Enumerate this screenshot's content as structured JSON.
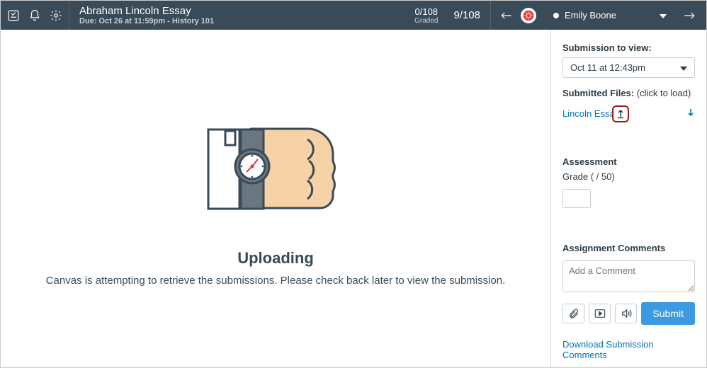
{
  "header": {
    "title": "Abraham Lincoln Essay",
    "subtitle": "Due: Oct 26 at 11:59pm - History 101",
    "graded_count": "0/108",
    "graded_label": "Graded",
    "position": "9/108",
    "student_name": "Emily Boone"
  },
  "main": {
    "heading": "Uploading",
    "message": "Canvas is attempting to retrieve the submissions. Please check back later to view the submission."
  },
  "sidebar": {
    "submission_label": "Submission to view:",
    "submission_selected": "Oct 11 at 12:43pm",
    "submitted_files_label": "Submitted Files:",
    "submitted_files_hint": "(click to load)",
    "file_name": "Lincoln Essa",
    "assessment_label": "Assessment",
    "grade_label": "Grade ( / 50)",
    "comments_label": "Assignment Comments",
    "comment_placeholder": "Add a Comment",
    "submit_label": "Submit",
    "download_link": "Download Submission Comments"
  }
}
